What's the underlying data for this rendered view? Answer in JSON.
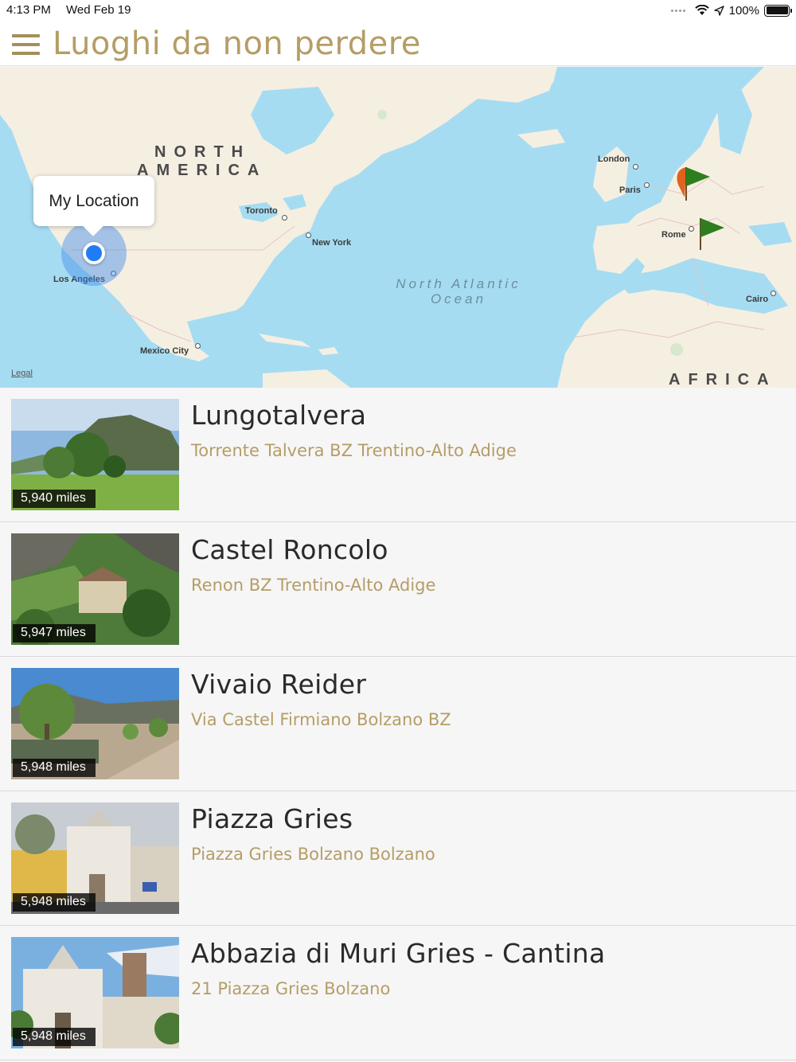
{
  "status_bar": {
    "time": "4:13 PM",
    "date": "Wed Feb 19",
    "battery": "100%",
    "icons": [
      "signal-dots-icon",
      "wifi-icon",
      "location-arrow-icon",
      "battery-icon"
    ]
  },
  "header": {
    "title": "Luoghi da non perdere",
    "menu_icon": "hamburger-menu-icon",
    "accent_color": "#b59d66"
  },
  "map": {
    "continents": [
      "NORTH",
      "AMERICA",
      "AFRICA"
    ],
    "ocean_lines": [
      "North Atlantic",
      "Ocean"
    ],
    "cities": [
      "Toronto",
      "New York",
      "Los Angeles",
      "Mexico City",
      "London",
      "Paris",
      "Rome",
      "Cairo"
    ],
    "legal": "Legal",
    "callout": "My Location",
    "pins": [
      "orange-flag-pin",
      "green-flag-pin",
      "green-flag-pin"
    ]
  },
  "places": [
    {
      "name": "Lungotalvera",
      "address": "Torrente Talvera BZ Trentino-Alto Adige",
      "distance": "5,940 miles"
    },
    {
      "name": "Castel Roncolo",
      "address": "Renon BZ Trentino-Alto Adige",
      "distance": "5,947 miles"
    },
    {
      "name": "Vivaio Reider",
      "address": "Via Castel Firmiano Bolzano BZ",
      "distance": "5,948 miles"
    },
    {
      "name": "Piazza Gries",
      "address": "Piazza Gries Bolzano Bolzano",
      "distance": "5,948 miles"
    },
    {
      "name": "Abbazia di Muri Gries - Cantina",
      "address": "21 Piazza Gries Bolzano",
      "distance": "5,948 miles"
    }
  ]
}
